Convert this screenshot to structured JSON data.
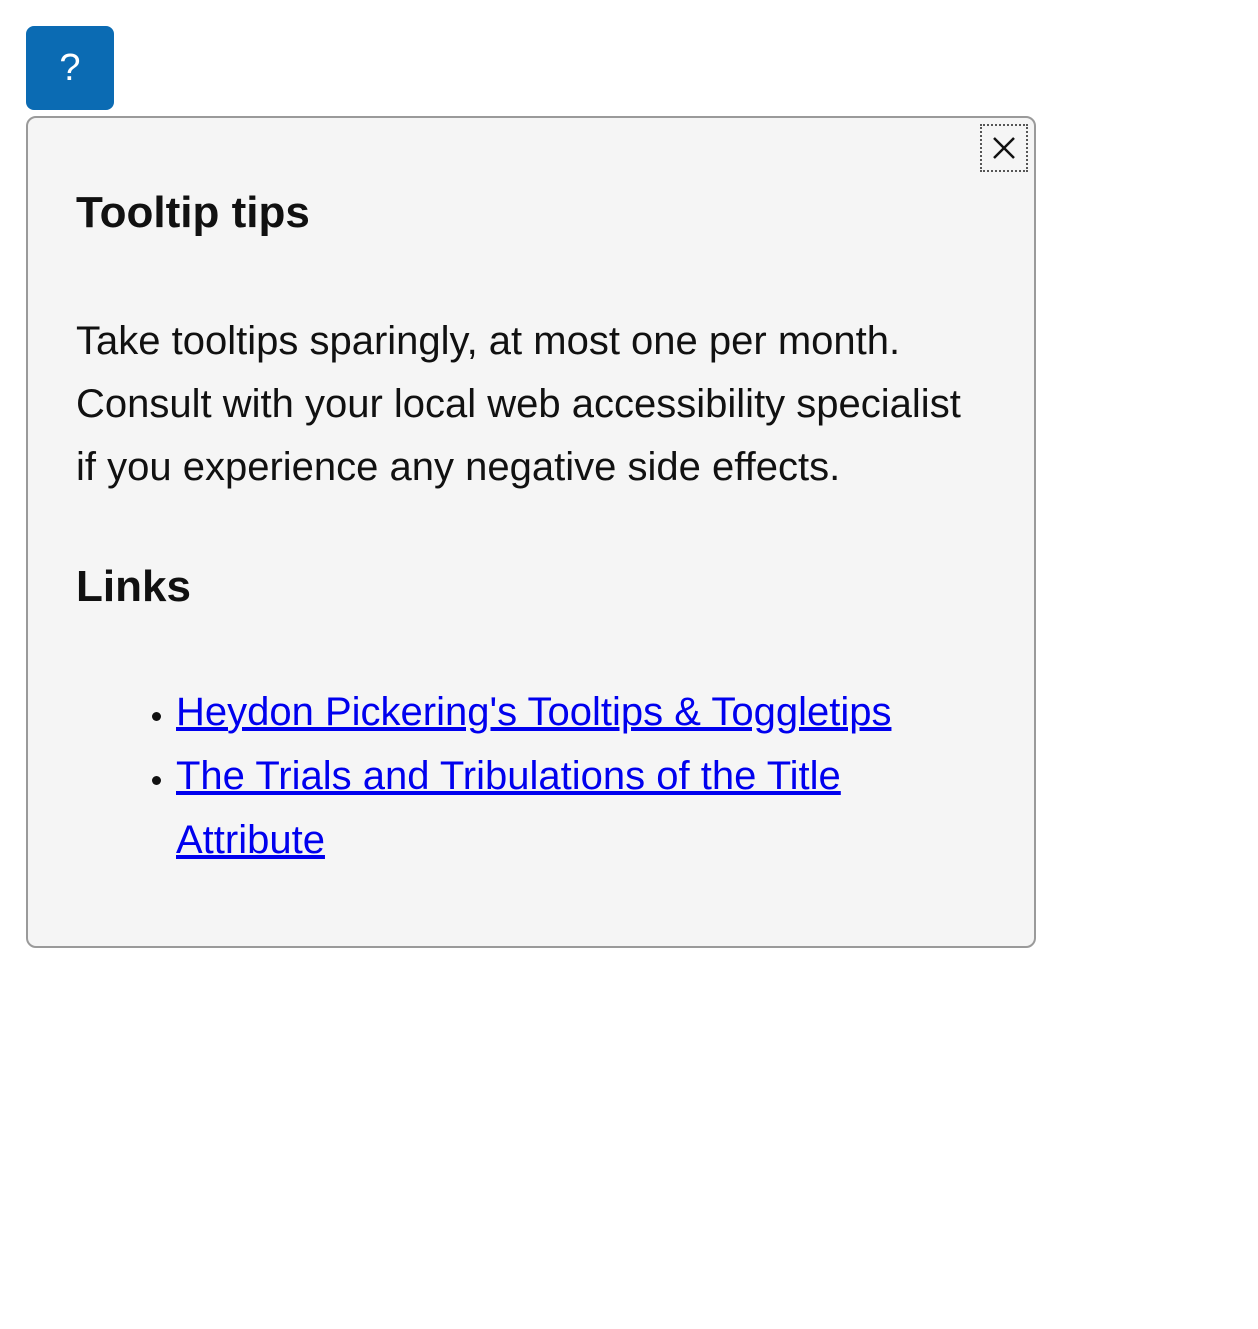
{
  "trigger": {
    "label": "?"
  },
  "tooltip": {
    "title": "Tooltip tips",
    "body": "Take tooltips sparingly, at most one per month. Consult with your local web accessibility specialist if you experience any negative side effects.",
    "links_heading": "Links",
    "links": [
      {
        "label": "Heydon Pickering's Tooltips & Toggletips"
      },
      {
        "label": "The Trials and Tribulations of the Title Attribute"
      }
    ]
  }
}
